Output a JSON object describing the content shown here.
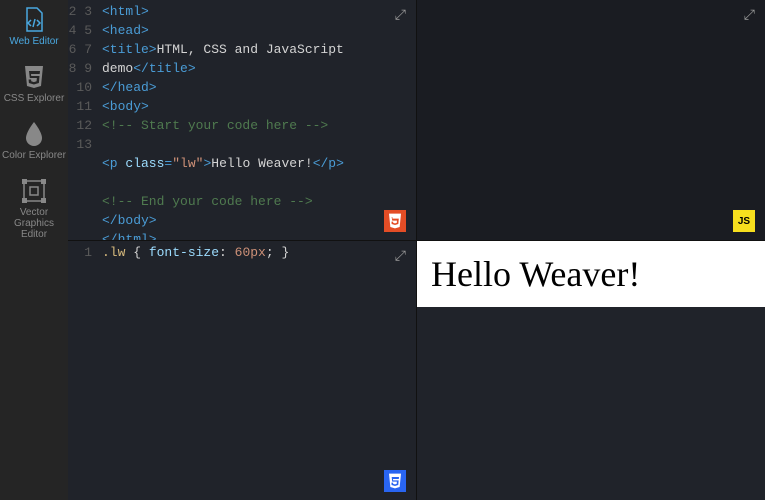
{
  "sidebar": {
    "items": [
      {
        "label": "Web Editor",
        "icon": "code-file",
        "active": true
      },
      {
        "label": "CSS Explorer",
        "icon": "css3",
        "active": false
      },
      {
        "label": "Color Explorer",
        "icon": "droplet",
        "active": false
      },
      {
        "label": "Vector Graphics Editor",
        "icon": "vector",
        "active": false
      }
    ]
  },
  "panes": {
    "html": {
      "lines": [
        {
          "n": 2,
          "segs": [
            {
              "c": "t-tag",
              "t": "<html>"
            }
          ]
        },
        {
          "n": 3,
          "segs": [
            {
              "c": "t-tag",
              "t": "<head>"
            }
          ]
        },
        {
          "n": 4,
          "segs": [
            {
              "c": "t-tag",
              "t": "<title>"
            },
            {
              "c": "t-txt",
              "t": "HTML, CSS and JavaScript "
            }
          ]
        },
        {
          "n": "",
          "segs": [
            {
              "c": "t-txt",
              "t": "demo"
            },
            {
              "c": "t-tag",
              "t": "</title>"
            }
          ]
        },
        {
          "n": 5,
          "segs": [
            {
              "c": "t-tag",
              "t": "</head>"
            }
          ]
        },
        {
          "n": 6,
          "segs": [
            {
              "c": "t-tag",
              "t": "<body>"
            }
          ]
        },
        {
          "n": 7,
          "segs": [
            {
              "c": "t-cmt",
              "t": "<!-- Start your code here -->"
            }
          ]
        },
        {
          "n": 8,
          "segs": []
        },
        {
          "n": 9,
          "segs": [
            {
              "c": "t-tag",
              "t": "<p "
            },
            {
              "c": "t-attr",
              "t": "class"
            },
            {
              "c": "t-tag",
              "t": "="
            },
            {
              "c": "t-str",
              "t": "\"lw\""
            },
            {
              "c": "t-tag",
              "t": ">"
            },
            {
              "c": "t-txt",
              "t": "Hello Weaver!"
            },
            {
              "c": "t-tag",
              "t": "</p>"
            }
          ]
        },
        {
          "n": 10,
          "segs": []
        },
        {
          "n": 11,
          "segs": [
            {
              "c": "t-cmt",
              "t": "<!-- End your code here -->"
            }
          ]
        },
        {
          "n": 12,
          "segs": [
            {
              "c": "t-tag",
              "t": "</body>"
            }
          ]
        },
        {
          "n": 13,
          "segs": [
            {
              "c": "t-tag",
              "t": "</html>"
            }
          ]
        }
      ],
      "badge": "HTML5"
    },
    "css": {
      "lines": [
        {
          "n": 1,
          "segs": [
            {
              "c": "t-sel",
              "t": ".lw"
            },
            {
              "c": "t-txt",
              "t": " { "
            },
            {
              "c": "t-prop",
              "t": "font-size"
            },
            {
              "c": "t-txt",
              "t": ": "
            },
            {
              "c": "t-val",
              "t": "60px"
            },
            {
              "c": "t-txt",
              "t": "; }"
            }
          ]
        }
      ],
      "badge": "CSS"
    },
    "js": {
      "badge": "JS"
    },
    "preview": {
      "text": "Hello Weaver!"
    }
  }
}
